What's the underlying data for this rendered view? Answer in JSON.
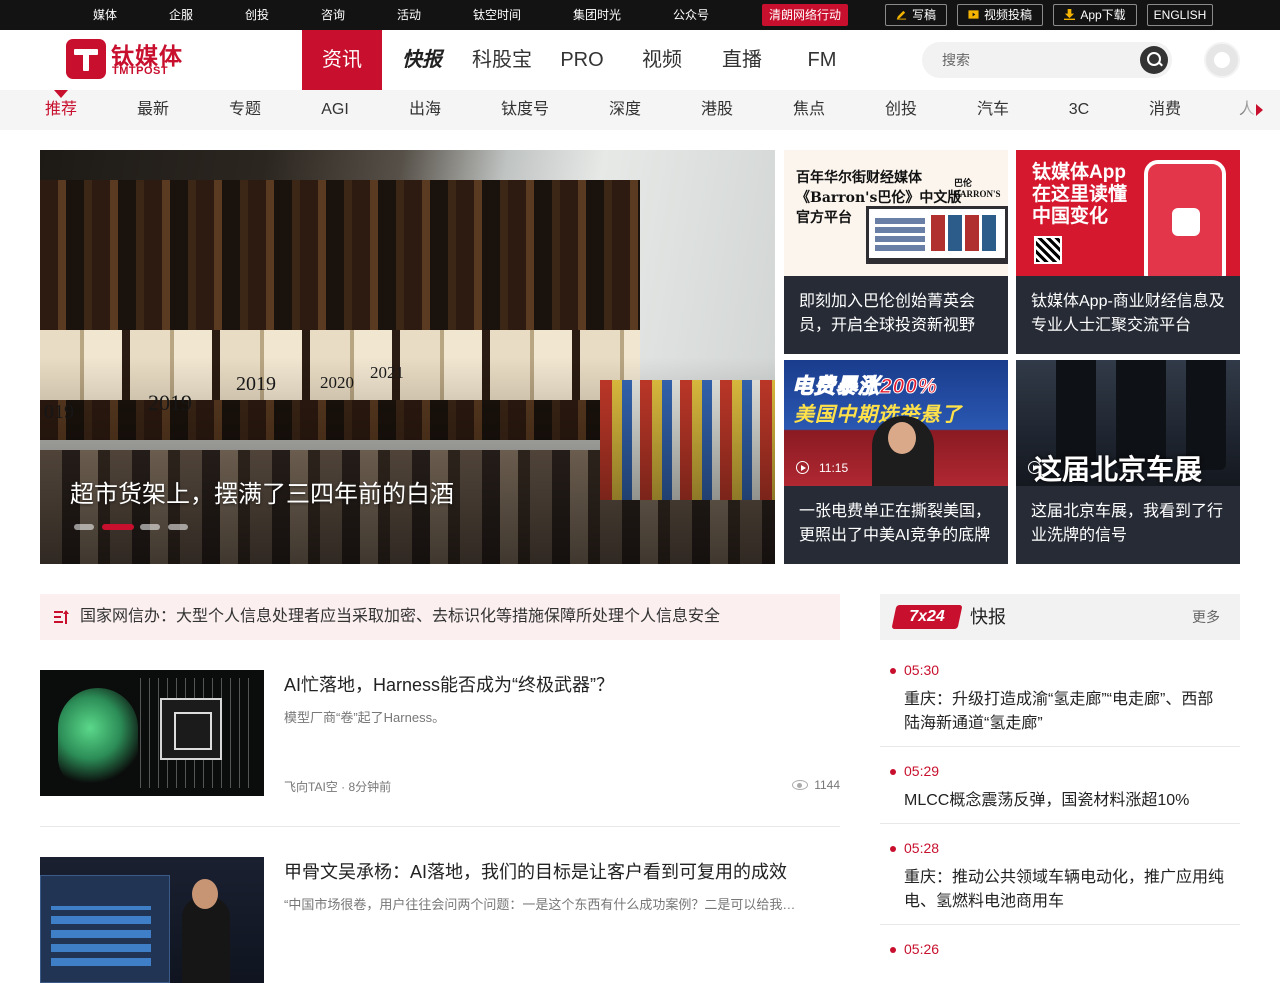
{
  "topbar": {
    "links": [
      "媒体",
      "企服",
      "创投",
      "咨询",
      "活动",
      "钛空时间",
      "集团时光",
      "公众号"
    ],
    "highlight": "清朗网络行动",
    "buttons": {
      "write": "写稿",
      "video": "视频投稿",
      "app": "App下载",
      "english": "ENGLISH"
    }
  },
  "header": {
    "logo_cn": "钛媒体",
    "logo_en": "TMTPOST",
    "nav": [
      "资讯",
      "快报",
      "科股宝",
      "PRO",
      "视频",
      "直播",
      "FM"
    ],
    "search_placeholder": "搜索"
  },
  "subnav": [
    "推荐",
    "最新",
    "专题",
    "AGI",
    "出海",
    "钛度号",
    "深度",
    "港股",
    "焦点",
    "创投",
    "汽车",
    "3C",
    "消费",
    "人"
  ],
  "hero": {
    "title": "超市货架上，摆满了三四年前的白酒",
    "bottle_years": [
      "019",
      "2019",
      "2020",
      "2021"
    ],
    "active_slide": 2,
    "slides": 4
  },
  "cards": [
    {
      "caption": "即刻加入巴伦创始菁英会员，开启全球投资新视野",
      "img_text": "百年华尔街财经媒体\n《Barron's巴伦》中文版\n官方平台",
      "img_brand": "巴伦 BARRON'S"
    },
    {
      "caption": "钛媒体App-商业财经信息及专业人士汇聚交流平台",
      "img_text": "钛媒体App\n在这里读懂\n中国变化"
    },
    {
      "caption": "一张电费单正在撕裂美国，更照出了中美AI竞争的底牌",
      "img_h1": "电费暴涨200%",
      "img_h2": "美国中期选举悬了",
      "duration": "11:15"
    },
    {
      "caption": "这届北京车展，我看到了行业洗牌的信号",
      "img_text": "这届北京车展"
    }
  ],
  "flash_bar": {
    "text": "国家网信办：大型个人信息处理者应当采取加密、去标识化等措施保障所处理个人信息安全"
  },
  "articles": [
    {
      "title": "AI忙落地，Harness能否成为“终极武器”？",
      "summary": "模型厂商“卷”起了Harness。",
      "meta": "飞向TAI空 · 8分钟前",
      "views": "1144"
    },
    {
      "title": "甲骨文吴承杨：AI落地，我们的目标是让客户看到可复用的成效",
      "summary": "“中国市场很卷，用户往往会问两个问题：一是这个东西有什么成功案例？二是可以给我…"
    }
  ],
  "sidebar": {
    "badge": "7x24",
    "title": "快报",
    "more": "更多",
    "items": [
      {
        "time": "05:30",
        "text": "重庆：升级打造成渝“氢走廊”“电走廊”、西部陆海新通道“氢走廊”"
      },
      {
        "time": "05:29",
        "text": "MLCC概念震荡反弹，国瓷材料涨超10%"
      },
      {
        "time": "05:28",
        "text": "重庆：推动公共领域车辆电动化，推广应用纯电、氢燃料电池商用车"
      },
      {
        "time": "05:26",
        "text": ""
      }
    ]
  },
  "colors": {
    "brand": "#c8102e",
    "topbar": "#131313",
    "subnav_bg": "#f5f5f5",
    "card_bg": "#262b36"
  }
}
